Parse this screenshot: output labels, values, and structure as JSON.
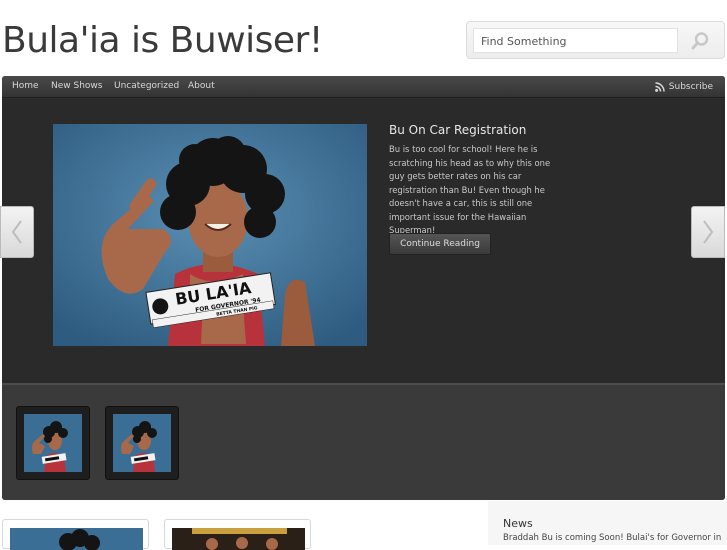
{
  "site": {
    "title": "Bula'ia is Buwiser!"
  },
  "search": {
    "placeholder": "Find Something"
  },
  "nav": {
    "items": [
      "Home",
      "New Shows",
      "Uncategorized",
      "About"
    ],
    "subscribe_label": "Subscribe"
  },
  "feature": {
    "title": "Bu On Car Registration",
    "text": "Bu is too cool for school!  Here he is scratching his head as to why this one guy gets better rates on his car registration than Bu!  Even though he doesn't have a car, this is still one important issue for the Hawaiian Superman!",
    "continue_label": "Continue Reading",
    "sign_text": "BU LA'IA",
    "sign_subtext": "FOR GOVERNOR '94",
    "sign_small": "BETTA THAN PIG"
  },
  "sidebar": {
    "news_title": "News",
    "news_text": "Braddah Bu is coming Soon! Bulai's for Governor in"
  },
  "colors": {
    "panel": "#2e2e2e",
    "photo_bg": "#3b6e95"
  },
  "icons": {
    "search": "magnifier-icon",
    "rss": "rss-icon",
    "prev": "chevron-left-icon",
    "next": "chevron-right-icon"
  }
}
